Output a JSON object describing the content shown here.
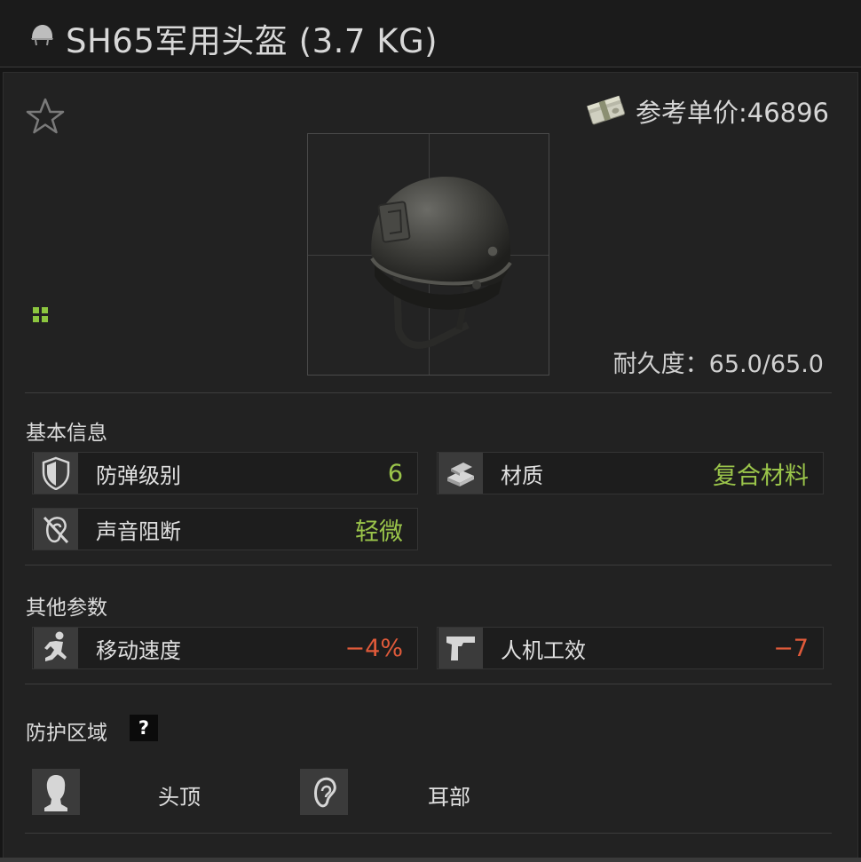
{
  "header": {
    "title": "SH65军用头盔 (3.7 KG)",
    "icon": "helmet-icon"
  },
  "item": {
    "favorite_icon": "star-outline-icon",
    "grid_icon": "inventory-grid-icon",
    "price_icon": "money-stack-icon",
    "price_text": "参考单价:46896",
    "durability_text": "耐久度：65.0/65.0",
    "image": "helmet-image"
  },
  "basic_info": {
    "title": "基本信息",
    "stats": [
      {
        "icon": "shield-icon",
        "label": "防弹级别",
        "value": "6",
        "tone": "good"
      },
      {
        "icon": "material-icon",
        "label": "材质",
        "value": "复合材料",
        "tone": "good"
      },
      {
        "icon": "ear-blocked-icon",
        "label": "声音阻断",
        "value": "轻微",
        "tone": "good"
      }
    ]
  },
  "other_params": {
    "title": "其他参数",
    "stats": [
      {
        "icon": "running-soldier-icon",
        "label": "移动速度",
        "value": "−4%",
        "tone": "bad"
      },
      {
        "icon": "pistol-icon",
        "label": "人机工效",
        "value": "−7",
        "tone": "bad"
      }
    ]
  },
  "protection": {
    "title": "防护区域",
    "help_label": "?",
    "zones": [
      {
        "icon": "head-top-icon",
        "label": "头顶"
      },
      {
        "icon": "ear-icon",
        "label": "耳部"
      }
    ]
  },
  "colors": {
    "positive": "#9ac44a",
    "negative": "#e05a3a",
    "background": "#222222"
  }
}
